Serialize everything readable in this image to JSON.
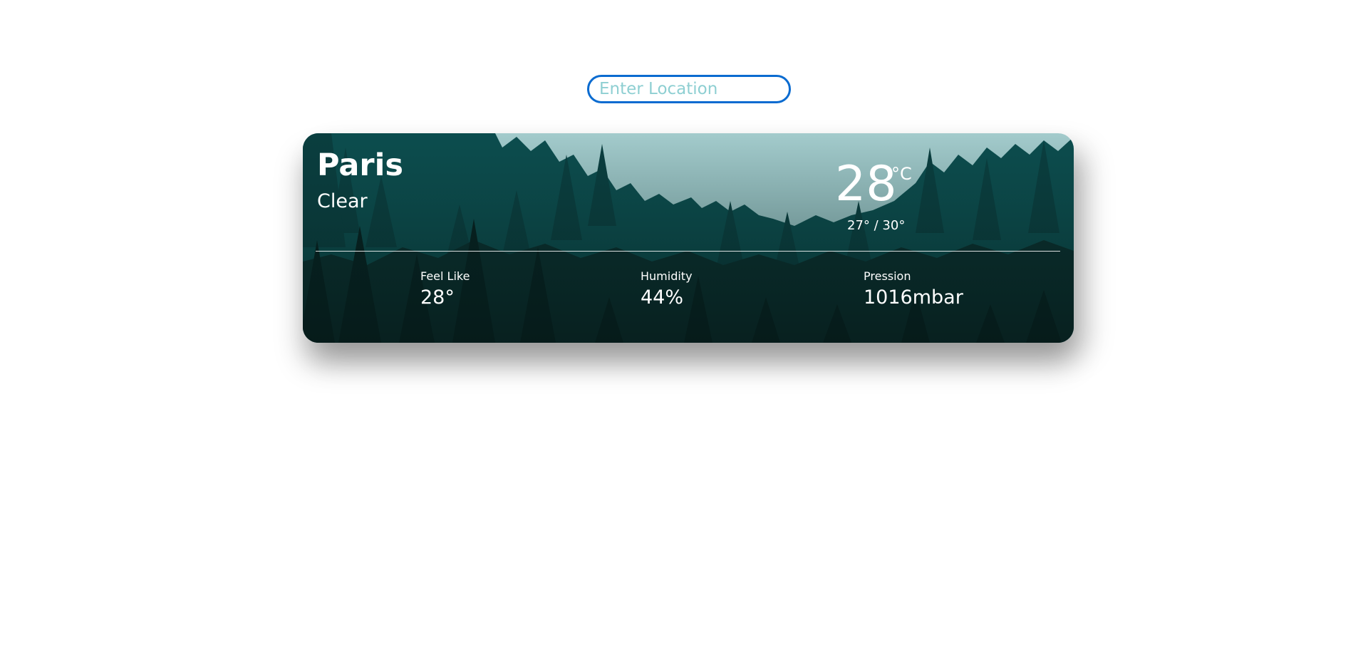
{
  "search": {
    "placeholder": "Enter Location",
    "value": ""
  },
  "weather": {
    "city": "Paris",
    "condition": "Clear",
    "temperature": "28",
    "unit": "°C",
    "range": "27° / 30°",
    "stats": {
      "feel_like": {
        "label": "Feel Like",
        "value": "28°"
      },
      "humidity": {
        "label": "Humidity",
        "value": "44%"
      },
      "pressure": {
        "label": "Pression",
        "value": "1016mbar"
      }
    }
  },
  "colors": {
    "input_border": "#0a6bd0",
    "placeholder": "#8ecfd2",
    "sky": "#a3cbcc",
    "forest_dark": "#0a2624",
    "forest_mid": "#0c4d4e"
  },
  "background_image": "misty pine forest silhouette"
}
